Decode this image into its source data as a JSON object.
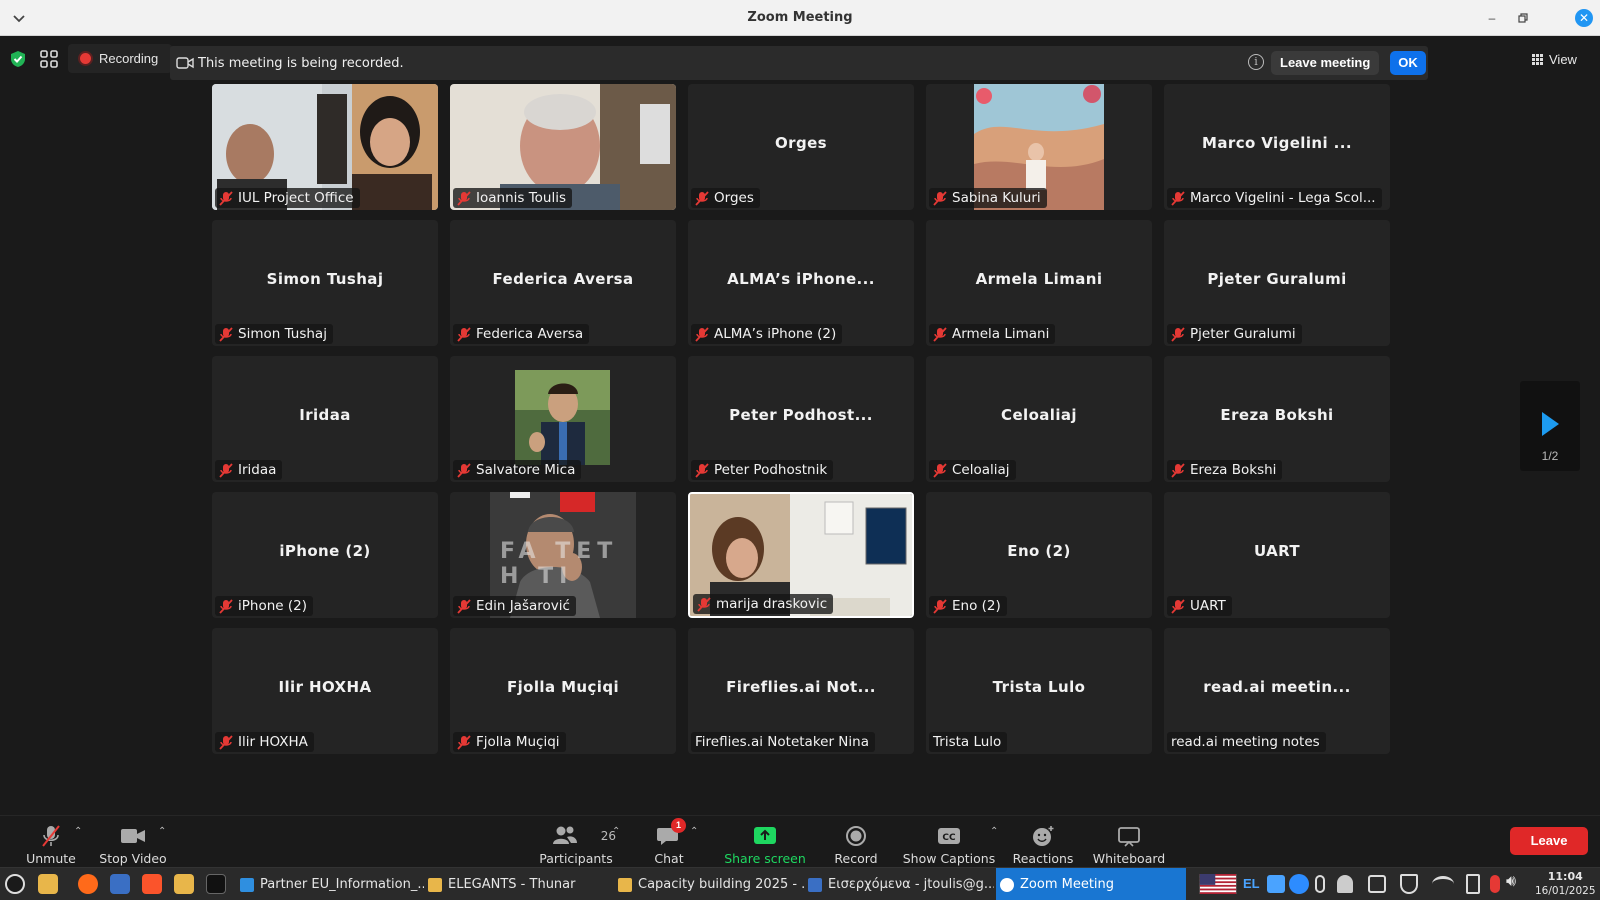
{
  "window": {
    "title": "Zoom Meeting"
  },
  "top_bar": {
    "recording_label": "Recording",
    "banner_text": "This meeting is being recorded.",
    "leave_meeting_label": "Leave meeting",
    "ok_label": "OK",
    "view_label": "View"
  },
  "tiles": [
    {
      "display": "",
      "name": "IUL Project Office",
      "muted": true
    },
    {
      "display": "",
      "name": "Ioannis Toulis",
      "muted": true
    },
    {
      "display": "Orges",
      "name": "Orges",
      "muted": true
    },
    {
      "display": "",
      "name": "Sabina Kuluri",
      "muted": true
    },
    {
      "display": "Marco Vigelini ...",
      "name": "Marco Vigelini - Lega Scol...",
      "muted": true
    },
    {
      "display": "Simon Tushaj",
      "name": "Simon Tushaj",
      "muted": true
    },
    {
      "display": "Federica Aversa",
      "name": "Federica Aversa",
      "muted": true
    },
    {
      "display": "ALMA’s iPhone...",
      "name": "ALMA’s iPhone (2)",
      "muted": true
    },
    {
      "display": "Armela Limani",
      "name": "Armela Limani",
      "muted": true
    },
    {
      "display": "Pjeter Guralumi",
      "name": "Pjeter Guralumi",
      "muted": true
    },
    {
      "display": "Iridaa",
      "name": "Iridaa",
      "muted": true
    },
    {
      "display": "",
      "name": "Salvatore Mica",
      "muted": true
    },
    {
      "display": "Peter Podhost...",
      "name": "Peter Podhostnik",
      "muted": true
    },
    {
      "display": "Celoaliaj",
      "name": "Celoaliaj",
      "muted": true
    },
    {
      "display": "Ereza Bokshi",
      "name": "Ereza Bokshi",
      "muted": true
    },
    {
      "display": "iPhone (2)",
      "name": "iPhone (2)",
      "muted": true
    },
    {
      "display": "",
      "name": "Edin Jašarović",
      "muted": true,
      "wall_text": "FA TET  H  TI"
    },
    {
      "display": "",
      "name": "marija draskovic",
      "muted": true
    },
    {
      "display": "Eno (2)",
      "name": "Eno (2)",
      "muted": true
    },
    {
      "display": "UART",
      "name": "UART",
      "muted": true
    },
    {
      "display": "Ilir HOXHA",
      "name": "Ilir HOXHA",
      "muted": true
    },
    {
      "display": "Fjolla Muçiqi",
      "name": "Fjolla Muçiqi",
      "muted": true
    },
    {
      "display": "Fireflies.ai Not...",
      "name": "Fireflies.ai Notetaker Nina",
      "muted": false
    },
    {
      "display": "Trista Lulo",
      "name": "Trista Lulo",
      "muted": false
    },
    {
      "display": "read.ai meetin...",
      "name": "read.ai meeting notes",
      "muted": false
    }
  ],
  "pagination": {
    "page": "1/2"
  },
  "toolbar": {
    "unmute": "Unmute",
    "stop_video": "Stop Video",
    "participants": "Participants",
    "participants_count": "26",
    "chat": "Chat",
    "chat_badge": "1",
    "share_screen": "Share screen",
    "record": "Record",
    "show_captions": "Show Captions",
    "reactions": "Reactions",
    "whiteboard": "Whiteboard",
    "leave": "Leave"
  },
  "taskbar": {
    "tasks": [
      {
        "label": "Partner EU_Information_...",
        "icon": "document-icon"
      },
      {
        "label": "ELEGANTS - Thunar",
        "icon": "folder-icon"
      },
      {
        "label": "Capacity building 2025 - ...",
        "icon": "folder-icon"
      },
      {
        "label": "Εισερχόμενα - jtoulis@g...",
        "icon": "mail-icon"
      },
      {
        "label": "Zoom Meeting",
        "icon": "zoom-icon"
      }
    ],
    "keyboard_layout": "EL",
    "time": "11:04",
    "date": "16/01/2025"
  },
  "colors": {
    "accent": "#0e71eb",
    "leave": "#e02828",
    "share_green": "#1ed760",
    "muted_red": "#e53935"
  }
}
